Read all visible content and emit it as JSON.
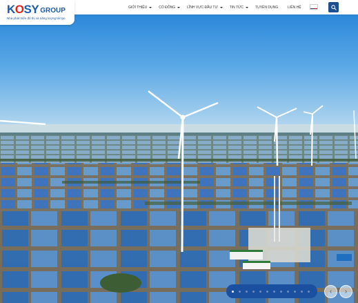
{
  "header": {
    "logo": {
      "brand_part1": "K",
      "brand_o": "O",
      "brand_part2": "SY",
      "brand_suffix": "GROUP",
      "tagline": "Nhà phát triển đô thị và năng lượng tái tạo"
    },
    "nav": [
      {
        "label": "GIỚI THIỆU",
        "has_dropdown": true
      },
      {
        "label": "CỔ ĐÔNG",
        "has_dropdown": true
      },
      {
        "label": "LĨNH VỰC ĐẦU TƯ",
        "has_dropdown": true
      },
      {
        "label": "TIN TỨC",
        "has_dropdown": true
      },
      {
        "label": "TUYỂN DỤNG",
        "has_dropdown": false
      },
      {
        "label": "LIÊN HỆ",
        "has_dropdown": false
      }
    ],
    "language_flag": "us-flag-icon",
    "search_icon": "search-icon"
  },
  "hero": {
    "image": "wind-turbines-over-shrimp-ponds"
  },
  "slider": {
    "dot_count": 12,
    "active_index": 0,
    "prev_icon": "chevron-left-icon",
    "next_icon": "chevron-right-icon",
    "prev_glyph": "‹",
    "next_glyph": "›"
  },
  "colors": {
    "brand_blue": "#1b5aa6",
    "brand_red": "#e2231a",
    "search_bg": "#1b4f8f",
    "dots_bar_bg": "#1b4fa0"
  }
}
